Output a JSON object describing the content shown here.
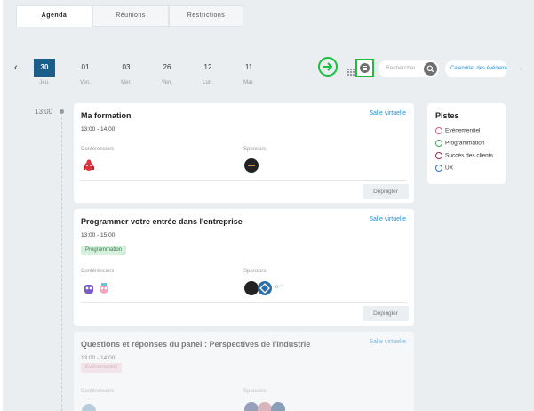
{
  "tabs": [
    "Agenda",
    "Réunions",
    "Restrictions"
  ],
  "nav": {
    "prev_glyph": "‹"
  },
  "days": [
    {
      "num": "30",
      "wd": "Jeu.",
      "active": true
    },
    {
      "num": "01",
      "wd": "Ven."
    },
    {
      "num": "03",
      "wd": "Mer."
    },
    {
      "num": "26",
      "wd": "Ven."
    },
    {
      "num": "12",
      "wd": "Lun."
    },
    {
      "num": "11",
      "wd": "Mar."
    }
  ],
  "toolbar": {
    "search_placeholder": "Rechercher",
    "calendar_label": "Calendrier des événements",
    "calendar_chevron": "⌄"
  },
  "timeline": {
    "time": "13:00"
  },
  "sessions": [
    {
      "title": "Ma formation",
      "room": "Salle virtuelle",
      "hours": "13:00 - 14:00",
      "speakers_label": "Conférenciers",
      "sponsors_label": "Sponsors",
      "unpin": "Dépingler"
    },
    {
      "title": "Programmer votre entrée dans l'entreprise",
      "room": "Salle virtuelle",
      "hours": "13:00 - 15:00",
      "tag": "Programmation",
      "speakers_label": "Conférenciers",
      "sponsors_label": "Sponsors",
      "sponsors_more": "o·°",
      "unpin": "Dépingler"
    },
    {
      "title": "Questions et réponses du panel : Perspectives de l'industrie",
      "room": "Salle virtuelle",
      "hours": "13:00 - 14:00",
      "tag": "Evénementiel",
      "speakers_label": "Conférenciers",
      "sponsors_label": "Sponsors"
    }
  ],
  "tracks": {
    "title": "Pistes",
    "items": [
      {
        "label": "Evénementiel",
        "color": "#d0607a"
      },
      {
        "label": "Programmation",
        "color": "#3fa55b"
      },
      {
        "label": "Succès des clients",
        "color": "#9a2a5a"
      },
      {
        "label": "UX",
        "color": "#2a6fd1"
      }
    ]
  },
  "colors": {
    "accent": "#1b5e8c",
    "link": "#2a8fd1",
    "highlight": "#1bbf3b"
  }
}
